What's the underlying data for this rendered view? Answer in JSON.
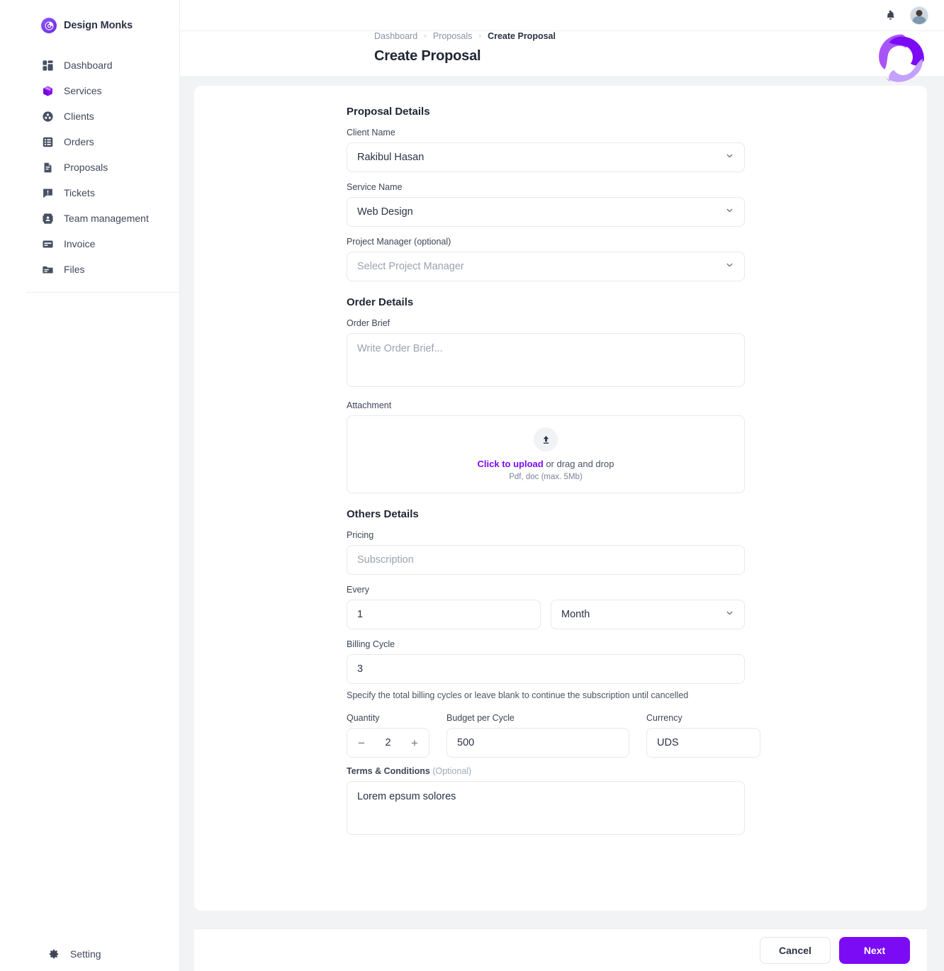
{
  "brand": {
    "name": "Design Monks",
    "icon": "monk-badge-icon"
  },
  "sidebar": {
    "items": [
      {
        "label": "Dashboard",
        "icon": "dashboard-icon"
      },
      {
        "label": "Services",
        "icon": "box-icon"
      },
      {
        "label": "Clients",
        "icon": "clients-icon"
      },
      {
        "label": "Orders",
        "icon": "orders-list-icon"
      },
      {
        "label": "Proposals",
        "icon": "proposal-doc-icon"
      },
      {
        "label": "Tickets",
        "icon": "ticket-chat-icon"
      },
      {
        "label": "Team management",
        "icon": "team-card-icon"
      },
      {
        "label": "Invoice",
        "icon": "invoice-card-icon"
      },
      {
        "label": "Files",
        "icon": "folder-icon"
      }
    ],
    "setting": {
      "label": "Setting",
      "icon": "gear-icon"
    }
  },
  "topbar": {
    "notification_icon": "bell-icon",
    "avatar_icon": "user-avatar",
    "logo_icon": "triskelion-logo"
  },
  "breadcrumb": {
    "items": [
      "Dashboard",
      "Proposals",
      "Create Proposal"
    ],
    "separator": "›"
  },
  "page": {
    "title": "Create Proposal"
  },
  "sections": {
    "proposal_details": {
      "title": "Proposal Details",
      "client_name": {
        "label": "Client Name",
        "value": "Rakibul Hasan",
        "icon": "chevron-down-icon"
      },
      "service_name": {
        "label": "Service Name",
        "value": "Web Design",
        "icon": "chevron-down-icon"
      },
      "project_manager": {
        "label": "Project Manager (optional)",
        "placeholder": "Select Project Manager",
        "icon": "chevron-down-icon"
      }
    },
    "order_details": {
      "title": "Order Details",
      "order_brief": {
        "label": "Order Brief",
        "placeholder": "Write Order Brief...",
        "value": ""
      },
      "attachment": {
        "label": "Attachment",
        "icon": "upload-icon",
        "link_text": "Click to upload",
        "rest_text": " or drag and drop",
        "hint": "Pdf, doc  (max. 5Mb)"
      }
    },
    "others_details": {
      "title": "Others Details",
      "pricing": {
        "label": "Pricing",
        "placeholder": "Subscription",
        "value": ""
      },
      "every": {
        "label": "Every",
        "count_value": "1",
        "unit_value": "Month",
        "unit_icon": "chevron-down-icon"
      },
      "billing_cycle": {
        "label": "Billing Cycle",
        "value": "3",
        "hint": "Specify the total billing cycles or leave blank to continue the subscription until cancelled"
      },
      "quantity": {
        "label": "Quantity",
        "value": "2",
        "minus": "−",
        "plus": "+"
      },
      "budget_per_cycle": {
        "label": "Budget per Cycle",
        "value": "500"
      },
      "currency": {
        "label": "Currency",
        "value": "UDS"
      },
      "terms": {
        "label": "Terms & Conditions",
        "optional": "(Optional)",
        "value": "Lorem epsum solores"
      }
    }
  },
  "footer": {
    "cancel_label": "Cancel",
    "next_label": "Next"
  },
  "colors": {
    "accent": "#7c0bf5",
    "brand_purple": "#8b5cf6",
    "page_bg": "#f2f3f5",
    "text_dark": "#1f2533",
    "text_muted": "#8a93a5",
    "border": "#e6e9ef"
  }
}
